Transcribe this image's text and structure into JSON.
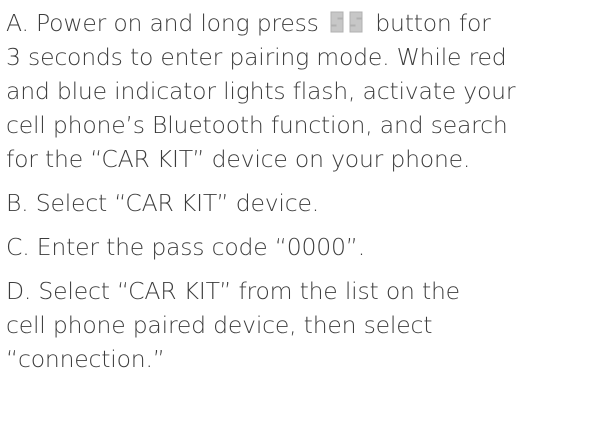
{
  "steps": [
    {
      "text_before_icon": "A. Power on and long press",
      "icon": "phone-button-icon",
      "text_after_icon": "button for",
      "lines": [
        "3 seconds to enter pairing mode. While red",
        "and blue indicator lights flash, activate your",
        "cell phone’s Bluetooth function, and search",
        "for the “CAR KIT” device on your phone."
      ]
    },
    {
      "lines": [
        "B. Select “CAR KIT” device."
      ]
    },
    {
      "lines": [
        "C. Enter the pass code “0000”."
      ]
    },
    {
      "lines": [
        "D. Select “CAR KIT” from the list on the",
        "cell phone paired device, then select",
        "“connection.”"
      ]
    }
  ],
  "colors": {
    "text": "#3c3c3c",
    "icon_fill": "#c7c7c7",
    "icon_stroke": "#b0b0b0"
  }
}
